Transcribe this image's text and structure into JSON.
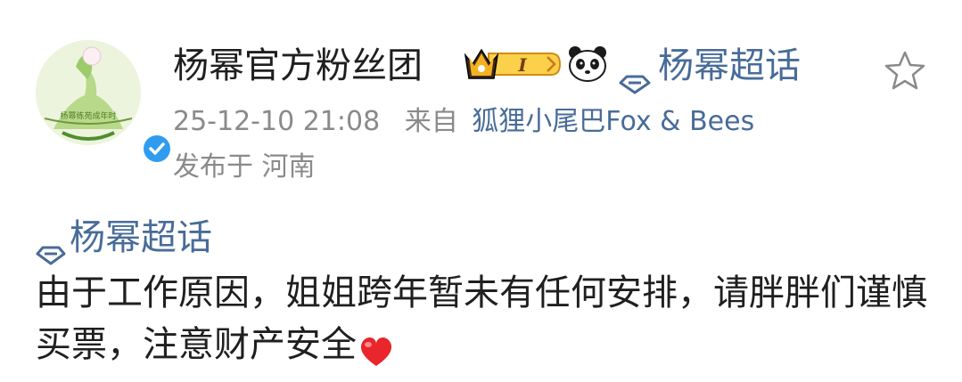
{
  "post": {
    "author_name": "杨幂官方粉丝团",
    "crown_badge_level": "I",
    "topic_header": "杨幂超话",
    "timestamp": "25-12-10 21:08",
    "source_prefix": "来自",
    "source_name": "狐狸小尾巴Fox & Bees",
    "location": "发布于 河南",
    "body_topic": "杨幂超话",
    "body_text": "由于工作原因，姐姐跨年暂未有任何安排，请胖胖们谨慎买票，注意财产安全",
    "avatar_caption": "杨幂练苑成年时",
    "icons": {
      "verified": "verified-check-icon",
      "crown": "crown-icon",
      "panda": "panda-icon",
      "topic": "diamond-icon",
      "favorite": "star-icon",
      "heart": "heart-icon"
    },
    "colors": {
      "link": "#486c98",
      "verified": "#2f9cf0",
      "badge": "#f5b021",
      "heart": "#e8262c"
    }
  }
}
